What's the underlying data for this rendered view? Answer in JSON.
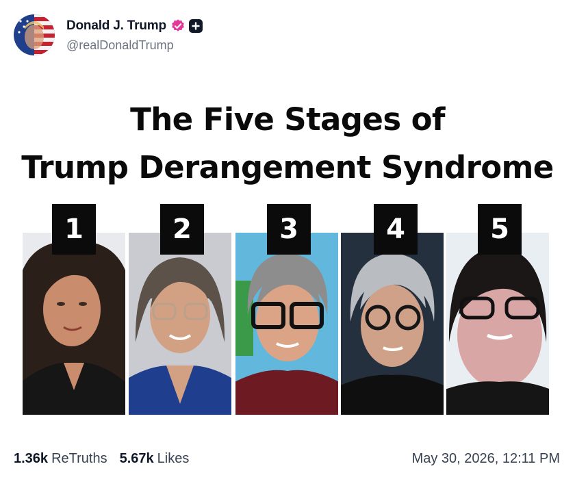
{
  "post": {
    "author": {
      "display_name": "Donald J. Trump",
      "handle": "@realDonaldTrump",
      "avatar_icon": "flag-portrait-avatar",
      "verified_icon": "verified-badge-icon",
      "verified_color": "#e1389a"
    },
    "media": {
      "title_line1": "The Five Stages of",
      "title_line2": "Trump Derangement Syndrome",
      "stages": [
        {
          "number": "1"
        },
        {
          "number": "2"
        },
        {
          "number": "3"
        },
        {
          "number": "4"
        },
        {
          "number": "5"
        }
      ]
    },
    "stats": {
      "retruths_count": "1.36k",
      "retruths_label": "ReTruths",
      "likes_count": "5.67k",
      "likes_label": "Likes"
    },
    "timestamp": "May 30, 2026, 12:11 PM"
  }
}
